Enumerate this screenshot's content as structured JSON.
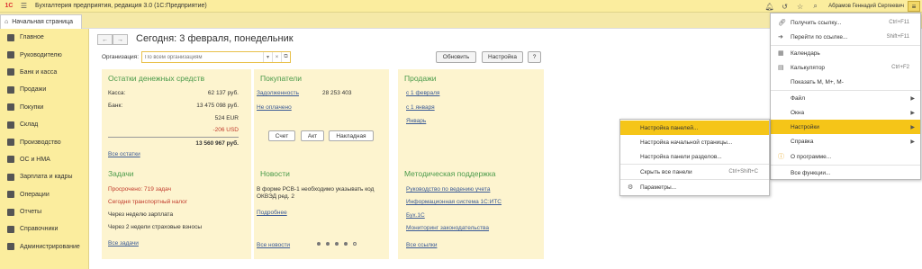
{
  "titlebar": {
    "logo": "1С",
    "app_title": "Бухгалтерия предприятия, редакция 3.0  (1С:Предприятие)",
    "user": "Абрамов Геннадий Сергеевич"
  },
  "tabs": {
    "home": "Начальная страница"
  },
  "sidebar": {
    "items": [
      {
        "label": "Главное"
      },
      {
        "label": "Руководителю"
      },
      {
        "label": "Банк и касса"
      },
      {
        "label": "Продажи"
      },
      {
        "label": "Покупки"
      },
      {
        "label": "Склад"
      },
      {
        "label": "Производство"
      },
      {
        "label": "ОС и НМА"
      },
      {
        "label": "Зарплата и кадры"
      },
      {
        "label": "Операции"
      },
      {
        "label": "Отчеты"
      },
      {
        "label": "Справочники"
      },
      {
        "label": "Администрирование"
      }
    ]
  },
  "main": {
    "title": "Сегодня: 3 февраля, понедельник",
    "org_label": "Организация:",
    "org_placeholder": "По всем организациям",
    "refresh": "Обновить",
    "settings": "Настройка",
    "help": "?"
  },
  "panels": {
    "balances": {
      "title": "Остатки денежных средств",
      "cash_label": "Касса:",
      "cash_value": "62 137 руб.",
      "bank_label": "Банк:",
      "bank_value": "13 475 098 руб.",
      "eur": "524 EUR",
      "usd": "-206 USD",
      "total": "13 560 967 руб.",
      "link": "Все остатки"
    },
    "buyers": {
      "title": "Покупатели",
      "debt": "Задолженность",
      "debt_value": "28 253 403",
      "unpaid": "Не оплачено",
      "btn_invoice": "Счет",
      "btn_act": "Акт",
      "btn_waybill": "Накладная"
    },
    "sales": {
      "title": "Продажи",
      "items": [
        "с 1 февраля",
        "с 1 января",
        "Январь"
      ]
    },
    "tasks": {
      "title": "Задачи",
      "overdue": "Просрочено: 719 задач",
      "today": "Сегодня транспортный налог",
      "week": "Через неделю зарплата",
      "two_weeks": "Через 2 недели страховые взносы",
      "link": "Все задачи"
    },
    "news": {
      "title": "Новости",
      "text": "В форме РСВ-1 необходимо указывать код ОКВЭД ред. 2",
      "more": "Подробнее",
      "link": "Все новости"
    },
    "support": {
      "title": "Методическая поддержка",
      "items": [
        "Руководство по ведению учета",
        "Информационная система 1С:ИТС",
        "Бух.1С",
        "Мониторинг законодательства"
      ],
      "link": "Все ссылки"
    }
  },
  "main_menu": {
    "items": [
      {
        "label": "Получить ссылку...",
        "shortcut": "Ctrl+F11"
      },
      {
        "label": "Перейти по ссылке...",
        "shortcut": "Shift+F11"
      },
      {
        "label": "Календарь"
      },
      {
        "label": "Калькулятор",
        "shortcut": "Ctrl+F2"
      },
      {
        "label": "Показать М, М+, М-"
      },
      {
        "label": "Файл"
      },
      {
        "label": "Окна"
      },
      {
        "label": "Настройки"
      },
      {
        "label": "Справка"
      },
      {
        "label": "О программе..."
      },
      {
        "label": "Все функции..."
      }
    ]
  },
  "sub_menu": {
    "items": [
      {
        "label": "Настройка панелей..."
      },
      {
        "label": "Настройка начальной страницы..."
      },
      {
        "label": "Настройка панели разделов..."
      },
      {
        "label": "Скрыть все панели",
        "shortcut": "Ctrl+Shift+C"
      },
      {
        "label": "Параметры..."
      }
    ]
  },
  "colors": {
    "accent": "#f5c518",
    "panel_bg": "#fdf4cf",
    "title_green": "#4a9a4a",
    "link": "#3a5a96"
  }
}
